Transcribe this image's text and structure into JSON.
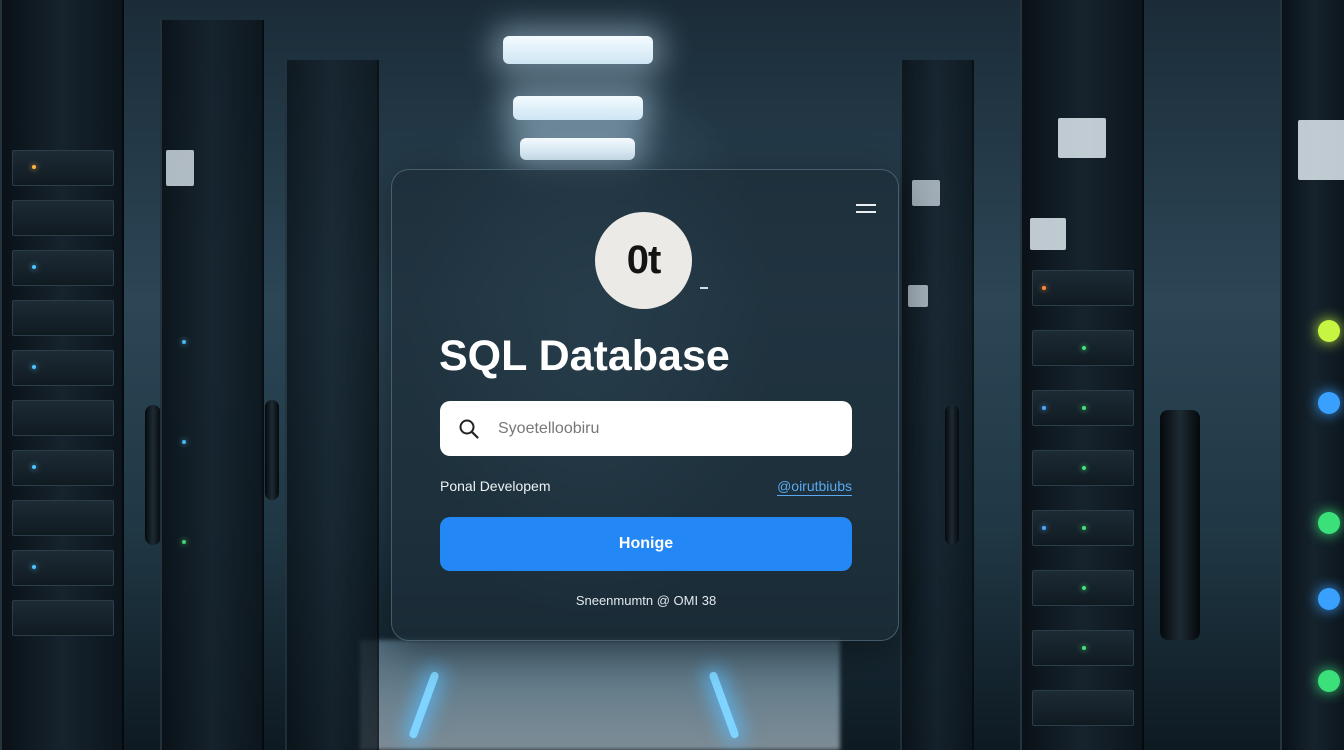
{
  "app": {
    "logo_text": "0t",
    "title": "SQL Database"
  },
  "search": {
    "placeholder": "Syoetelloobiru"
  },
  "links": {
    "left_label": "Ponal Developem",
    "right_label": "@oirutbiubs"
  },
  "primary_button": {
    "label": "Honige"
  },
  "footer": {
    "text": "Sneenmumtn @ OMI 38"
  },
  "colors": {
    "accent": "#2388f5",
    "link": "#5aa9f0",
    "card_background": "#1c2c38"
  },
  "icons": {
    "menu": "menu-icon",
    "search": "search-icon"
  }
}
